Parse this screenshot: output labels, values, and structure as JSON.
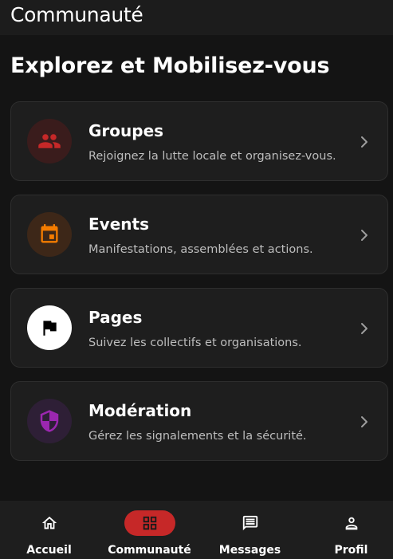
{
  "header": {
    "title": "Communauté"
  },
  "main": {
    "heading": "Explorez et Mobilisez-vous",
    "cards": [
      {
        "title": "Groupes",
        "subtitle": "Rejoignez la lutte locale et organisez-vous.",
        "icon": "groups-icon",
        "icon_bg": "#3a1c1c",
        "icon_color": "#c62828"
      },
      {
        "title": "Events",
        "subtitle": "Manifestations, assemblées et actions.",
        "icon": "calendar-icon",
        "icon_bg": "#3d2718",
        "icon_color": "#f57c00"
      },
      {
        "title": "Pages",
        "subtitle": "Suivez les collectifs et organisations.",
        "icon": "flag-icon",
        "icon_bg": "#ffffff",
        "icon_color": "#000000"
      },
      {
        "title": "Modération",
        "subtitle": "Gérez les signalements et la sécurité.",
        "icon": "shield-icon",
        "icon_bg": "#2e1f36",
        "icon_color": "#9c27b0"
      }
    ]
  },
  "bottom_nav": {
    "active": "Communauté",
    "active_color": "#c62828",
    "items": [
      {
        "label": "Accueil",
        "icon": "home-icon"
      },
      {
        "label": "Communauté",
        "icon": "grid-icon"
      },
      {
        "label": "Messages",
        "icon": "message-icon"
      },
      {
        "label": "Profil",
        "icon": "person-icon"
      }
    ]
  }
}
